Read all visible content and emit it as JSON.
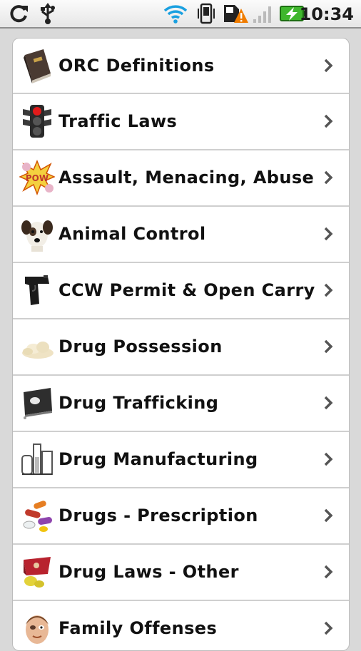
{
  "status_bar": {
    "time": "10:34",
    "icons": [
      "sync-icon",
      "usb-icon",
      "wifi-icon",
      "vibrate-icon",
      "sd-card-warning-icon",
      "signal-icon",
      "battery-charging-icon"
    ]
  },
  "list": {
    "items": [
      {
        "label": "ORC Definitions",
        "icon": "law-book-icon"
      },
      {
        "label": "Traffic Laws",
        "icon": "traffic-light-icon"
      },
      {
        "label": "Assault, Menacing, Abuse",
        "icon": "pow-burst-icon"
      },
      {
        "label": "Animal Control",
        "icon": "dog-icon"
      },
      {
        "label": "CCW Permit & Open Carry",
        "icon": "handgun-icon"
      },
      {
        "label": "Drug Possession",
        "icon": "powder-icon"
      },
      {
        "label": "Drug Trafficking",
        "icon": "trafficking-icon"
      },
      {
        "label": "Drug Manufacturing",
        "icon": "lab-equipment-icon"
      },
      {
        "label": "Drugs - Prescription",
        "icon": "pills-icon"
      },
      {
        "label": "Drug Laws - Other",
        "icon": "drug-other-icon"
      },
      {
        "label": "Family Offenses",
        "icon": "face-icon"
      }
    ]
  },
  "colors": {
    "background": "#d9d9d9",
    "list_bg": "#ffffff",
    "text": "#111111",
    "chevron": "#555555",
    "battery": "#3fb62d",
    "warning": "#f07c00"
  }
}
